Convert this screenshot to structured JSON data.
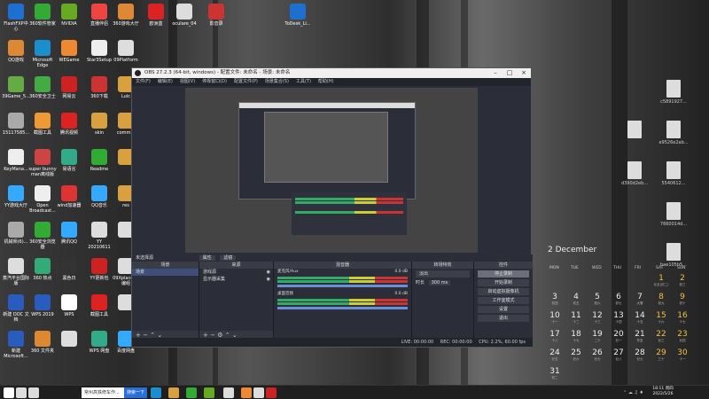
{
  "desktop": {
    "icons_col1": [
      {
        "label": "FlashFXP中心",
        "color": "#1e6fd0"
      },
      {
        "label": "QQ游戏",
        "color": "#d83"
      },
      {
        "label": "39Game_5...",
        "color": "#6a4"
      },
      {
        "label": "15117585...",
        "color": "#aaa"
      },
      {
        "label": "KeyMana...",
        "color": "#eee"
      },
      {
        "label": "YY游戏大厅",
        "color": "#3af"
      },
      {
        "label": "机械师(6)...",
        "color": "#aaa"
      },
      {
        "label": "蒸汽平台国际版",
        "color": "#ddd"
      },
      {
        "label": "新建 DOC 文档",
        "color": "#2a5cc0"
      },
      {
        "label": "新建 Microsoft...",
        "color": "#2a5cc0"
      }
    ],
    "icons_col2": [
      {
        "label": "360软件管家",
        "color": "#3a3"
      },
      {
        "label": "Microsoft Edge",
        "color": "#1a8fd0"
      },
      {
        "label": "360安全卫士",
        "color": "#4a4"
      },
      {
        "label": "截图工具",
        "color": "#e93"
      },
      {
        "label": "super bunny man离线版",
        "color": "#c44"
      },
      {
        "label": "Open Broadcast...",
        "color": "#eee"
      },
      {
        "label": "360安全浏览器",
        "color": "#3a3"
      },
      {
        "label": "360 热点",
        "color": "#3a7"
      },
      {
        "label": "WPS 2019",
        "color": "#2a5cc0"
      },
      {
        "label": "360 文件夹",
        "color": "#d83"
      }
    ],
    "icons_col3": [
      {
        "label": "NVIDIA",
        "color": "#6a2"
      },
      {
        "label": "WEGame",
        "color": "#e83"
      },
      {
        "label": "网易云",
        "color": "#c22"
      },
      {
        "label": "腾讯视频",
        "color": "#d22"
      },
      {
        "label": "易语言",
        "color": "#3a8"
      },
      {
        "label": "wind加速器",
        "color": "#d33"
      },
      {
        "label": "腾讯QQ",
        "color": "#3af"
      },
      {
        "label": "黑色日",
        "color": "#333"
      },
      {
        "label": "WPS",
        "color": "#fff"
      },
      {
        "label": "",
        "color": "#ddd"
      }
    ],
    "icons_col4": [
      {
        "label": "直播伴侣",
        "color": "#e44"
      },
      {
        "label": "Star3Setup",
        "color": "#eee"
      },
      {
        "label": "360下载",
        "color": "#c33"
      },
      {
        "label": "skin",
        "color": "#d9a040"
      },
      {
        "label": "Readme",
        "color": "#3a3"
      },
      {
        "label": "QQ音乐",
        "color": "#3af"
      },
      {
        "label": "YY 20210611",
        "color": "#ddd"
      },
      {
        "label": "YY更新包",
        "color": "#c22"
      },
      {
        "label": "截图工具",
        "color": "#d22"
      },
      {
        "label": "WPS 网盘",
        "color": "#3a8"
      }
    ],
    "icons_col5": [
      {
        "label": "360游戏大厅",
        "color": "#d83"
      },
      {
        "label": "09Platform",
        "color": "#ddd"
      },
      {
        "label": "Luic",
        "color": "#d9a040"
      },
      {
        "label": "comm...",
        "color": "#d9a040"
      },
      {
        "label": "",
        "color": "#d9a040"
      },
      {
        "label": "res",
        "color": "#d9a040"
      },
      {
        "label": "",
        "color": "#ddd"
      },
      {
        "label": "09Xplace 初编组",
        "color": "#ddd"
      },
      {
        "label": "",
        "color": "#ddd"
      },
      {
        "label": "百度网盘",
        "color": "#3af"
      }
    ],
    "icons_top_extra": [
      {
        "label": "欧洲蓝",
        "color": "#d22"
      },
      {
        "label": "oculare_04",
        "color": "#ddd"
      },
      {
        "label": "影音录",
        "color": "#c33"
      },
      {
        "label": "ToDesk_Li...",
        "color": "#1e6fd0"
      }
    ],
    "right_files": [
      {
        "label": "c5891927..."
      },
      {
        "label": "e9526e2ab..."
      },
      {
        "label": "5540612..."
      },
      {
        "label": "7660014d..."
      },
      {
        "label": "bae105b5..."
      }
    ],
    "right_files_left": [
      {
        "label": ""
      },
      {
        "label": "d390d2eb..."
      }
    ]
  },
  "obs": {
    "title": "OBS 27.2.3 (64-bit, windows) - 配置文件: 未命名 - 场景: 未命名",
    "menu": [
      "文件(F)",
      "编辑(E)",
      "视图(V)",
      "停靠窗口(D)",
      "配置文件(P)",
      "场景集合(S)",
      "工具(T)",
      "帮助(H)"
    ],
    "no_source_label": "未选择源",
    "properties_btn": "属性",
    "filters_btn": "滤镜",
    "docks": {
      "scenes": {
        "title": "场景",
        "items": [
          "场景"
        ]
      },
      "sources": {
        "title": "来源",
        "items": [
          "游戏源",
          "显示器采集"
        ]
      },
      "mixer": {
        "title": "混音器",
        "tracks": [
          {
            "name": "麦克风/Aux",
            "db": "0.0 dB"
          },
          {
            "name": "桌面音频",
            "db": "0.0 dB"
          }
        ]
      },
      "transitions": {
        "title": "转场特效",
        "type": "淡出",
        "duration_label": "时长",
        "duration": "300 ms"
      },
      "controls": {
        "title": "控件",
        "buttons": [
          "停止录制",
          "开始录制",
          "启动虚拟摄像机",
          "工作室模式",
          "设置",
          "退出"
        ]
      }
    },
    "status": {
      "live": "LIVE: 00:00:00",
      "rec": "REC: 00:00:00",
      "cpu": "CPU: 2.2%, 60.00 fps"
    }
  },
  "calendar": {
    "month": "2 December",
    "weekdays": [
      "MON",
      "TUE",
      "WED",
      "THU",
      "FRI",
      "SAT",
      "SUN"
    ],
    "rows": [
      [
        {
          "d": "",
          "s": ""
        },
        {
          "d": "",
          "s": ""
        },
        {
          "d": "",
          "s": ""
        },
        {
          "d": "",
          "s": ""
        },
        {
          "d": "",
          "s": ""
        },
        {
          "d": "1",
          "s": "元旦(初二)",
          "h": true
        },
        {
          "d": "2",
          "s": "初三",
          "h": true
        }
      ],
      [
        {
          "d": "3",
          "s": "初四"
        },
        {
          "d": "4",
          "s": "初五"
        },
        {
          "d": "5",
          "s": "初六"
        },
        {
          "d": "6",
          "s": "初七"
        },
        {
          "d": "7",
          "s": "大雪"
        },
        {
          "d": "8",
          "s": "初九",
          "h": true
        },
        {
          "d": "9",
          "s": "初十",
          "h": true
        }
      ],
      [
        {
          "d": "10",
          "s": "十一"
        },
        {
          "d": "11",
          "s": "十二"
        },
        {
          "d": "12",
          "s": "十三"
        },
        {
          "d": "13",
          "s": "十四"
        },
        {
          "d": "14",
          "s": "十五"
        },
        {
          "d": "15",
          "s": "十六",
          "h": true
        },
        {
          "d": "16",
          "s": "十七",
          "h": true
        }
      ],
      [
        {
          "d": "17",
          "s": "十八"
        },
        {
          "d": "18",
          "s": "十九"
        },
        {
          "d": "19",
          "s": "二十"
        },
        {
          "d": "20",
          "s": "廿一"
        },
        {
          "d": "21",
          "s": "冬至"
        },
        {
          "d": "22",
          "s": "廿三",
          "h": true
        },
        {
          "d": "23",
          "s": "廿四",
          "h": true
        }
      ],
      [
        {
          "d": "24",
          "s": "廿五"
        },
        {
          "d": "25",
          "s": "廿六"
        },
        {
          "d": "26",
          "s": "廿七"
        },
        {
          "d": "27",
          "s": "廿八"
        },
        {
          "d": "28",
          "s": "廿九"
        },
        {
          "d": "29",
          "s": "三十",
          "h": true
        },
        {
          "d": "30",
          "s": "十一",
          "h": true
        }
      ],
      [
        {
          "d": "31",
          "s": "初二"
        },
        {
          "d": "",
          "s": ""
        },
        {
          "d": "",
          "s": ""
        },
        {
          "d": "",
          "s": ""
        },
        {
          "d": "",
          "s": ""
        },
        {
          "d": "",
          "s": ""
        },
        {
          "d": "",
          "s": ""
        }
      ]
    ]
  },
  "taskbar": {
    "search_placeholder": "常州高铁修车作...",
    "search_button": "搜索一下",
    "clock_time": "18:11 周四",
    "clock_date": "2022/5/26",
    "apps": [
      {
        "name": "start-icon",
        "color": "#fff"
      },
      {
        "name": "search-icon",
        "color": "#ddd"
      },
      {
        "name": "task-view-icon",
        "color": "#ddd"
      },
      {
        "name": "edge-taskbar-icon",
        "color": "#1a8fd0"
      },
      {
        "name": "folder-taskbar-icon",
        "color": "#d9a040"
      },
      {
        "name": "wechat-taskbar-icon",
        "color": "#3a3"
      },
      {
        "name": "nvidia-taskbar-icon",
        "color": "#6a2"
      },
      {
        "name": "obs-taskbar-icon",
        "color": "#ddd"
      },
      {
        "name": "store-taskbar-icon",
        "color": "#e83"
      },
      {
        "name": "cursor-taskbar-icon",
        "color": "#ddd"
      },
      {
        "name": "record-taskbar-icon",
        "color": "#c22"
      }
    ]
  }
}
